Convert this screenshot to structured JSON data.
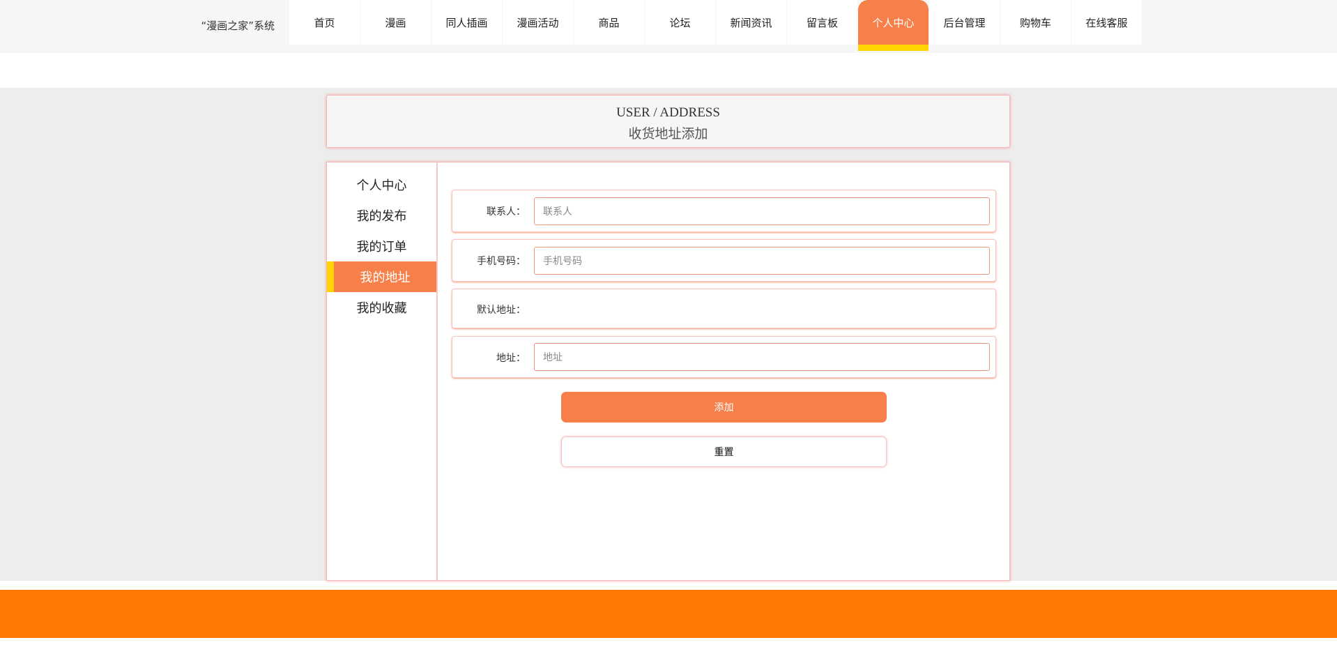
{
  "brand": "“漫画之家”系统",
  "nav": [
    "首页",
    "漫画",
    "同人插画",
    "漫画活动",
    "商品",
    "论坛",
    "新闻资讯",
    "留言板",
    "个人中心",
    "后台管理",
    "购物车",
    "在线客服"
  ],
  "nav_active_index": 8,
  "header": {
    "en": "USER / ADDRESS",
    "cn": "收货地址添加"
  },
  "sidebar": [
    "个人中心",
    "我的发布",
    "我的订单",
    "我的地址",
    "我的收藏"
  ],
  "sidebar_active_index": 3,
  "form": {
    "contact": {
      "label": "联系人：",
      "placeholder": "联系人",
      "value": ""
    },
    "phone": {
      "label": "手机号码：",
      "placeholder": "手机号码",
      "value": ""
    },
    "default": {
      "label": "默认地址："
    },
    "address": {
      "label": "地址：",
      "placeholder": "地址",
      "value": ""
    }
  },
  "buttons": {
    "add": "添加",
    "reset": "重置"
  },
  "colors": {
    "accent": "#f7804a",
    "highlight": "#ffd400",
    "footer": "#ff7804"
  }
}
